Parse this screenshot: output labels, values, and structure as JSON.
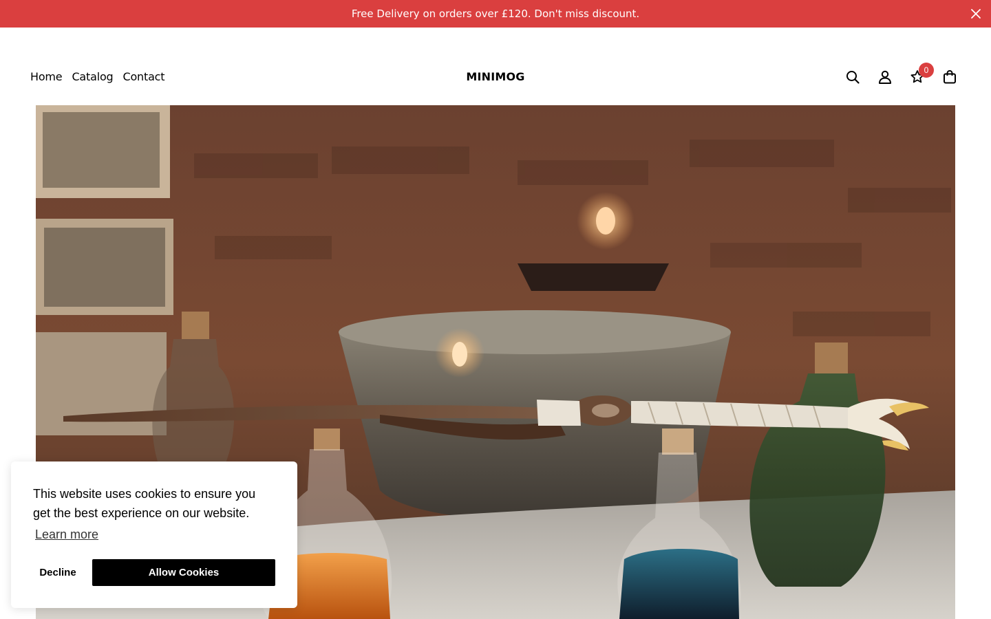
{
  "announcement": {
    "text": "Free Delivery on orders over £120. Don't miss discount.",
    "close_icon": "close-icon",
    "background": "#da3f3f"
  },
  "header": {
    "nav": [
      {
        "label": "Home"
      },
      {
        "label": "Catalog"
      },
      {
        "label": "Contact"
      }
    ],
    "logo": "MINIMOG",
    "icons": [
      "search-icon",
      "account-icon",
      "wishlist-star-icon",
      "cart-bag-icon"
    ],
    "wishlist_count": "0",
    "badge_color": "#da3f3f"
  },
  "hero": {
    "image_alt": "Carved wooden wand resting on potion bottles in candlelit room"
  },
  "cookie_banner": {
    "message": "This website uses cookies to ensure you get the best experience on our website.",
    "learn_more": "Learn more",
    "decline": "Decline",
    "allow": "Allow Cookies"
  }
}
